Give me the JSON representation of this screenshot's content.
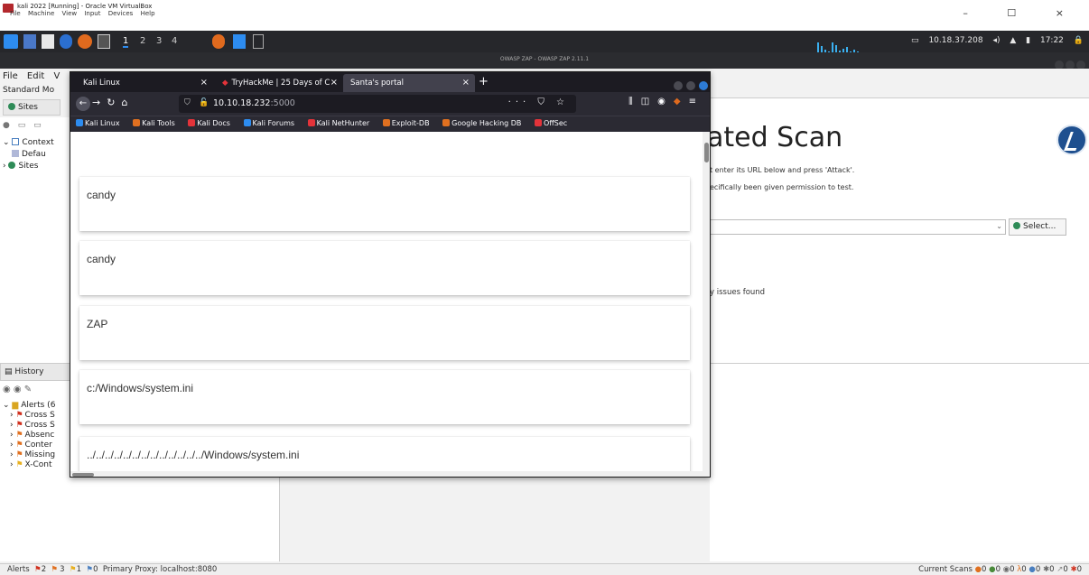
{
  "vbox": {
    "title": "kali 2022 [Running] - Oracle VM VirtualBox",
    "menu": [
      "File",
      "Machine",
      "View",
      "Input",
      "Devices",
      "Help"
    ],
    "window_controls": "– ☐ ×"
  },
  "kali_panel": {
    "workspaces": [
      "1",
      "2",
      "3",
      "4"
    ],
    "ip": "10.18.37.208",
    "clock": "17:22"
  },
  "zap": {
    "window_title": "OWASP ZAP - OWASP ZAP 2.11.1",
    "menu": [
      "File",
      "Edit",
      "V"
    ],
    "mode": "Standard Mo",
    "sites_tab": "Sites",
    "tree": {
      "contexts": "Context",
      "default": "Defau",
      "sites": "Sites"
    },
    "history_tab": "History",
    "alerts": {
      "root": "Alerts (6",
      "items": [
        "Cross S",
        "Cross S",
        "Absenc",
        "Conter",
        "Missing",
        "X-Cont"
      ]
    },
    "quick_start": {
      "heading": "ated Scan",
      "desc1": "t enter its URL below and press 'Attack'.",
      "desc2": "ecifically been given permission to test.",
      "select_label": "Select...",
      "issues": "y issues found"
    },
    "status_bar": {
      "left": "Alerts",
      "alert_counts": [
        "2",
        "3",
        "1",
        "0"
      ],
      "proxy": "Primary Proxy: localhost:8080",
      "right_label": "Current Scans",
      "scan_counts": [
        "0",
        "0",
        "0",
        "0",
        "0",
        "0",
        "0",
        "0"
      ]
    }
  },
  "firefox": {
    "tabs": [
      {
        "label": "Kali Linux"
      },
      {
        "label": "TryHackMe | 25 Days of C"
      },
      {
        "label": "Santa's portal"
      }
    ],
    "url": {
      "host": "10.10.18.232",
      "port": ":5000"
    },
    "url_actions": "··· ⛉ ☆",
    "bookmarks": [
      "Kali Linux",
      "Kali Tools",
      "Kali Docs",
      "Kali Forums",
      "Kali NetHunter",
      "Exploit-DB",
      "Google Hacking DB",
      "OffSec"
    ],
    "cards": [
      "candy",
      "candy",
      "ZAP",
      "c:/Windows/system.ini",
      "../../../../../../../../../../../../../Windows/system.ini"
    ]
  },
  "colors": {
    "kali_panel_bg": "#26272b",
    "firefox_chrome": "#2b2a33",
    "firefox_tabbar": "#1c1b22",
    "zap_logo": "#1e4f8f"
  }
}
